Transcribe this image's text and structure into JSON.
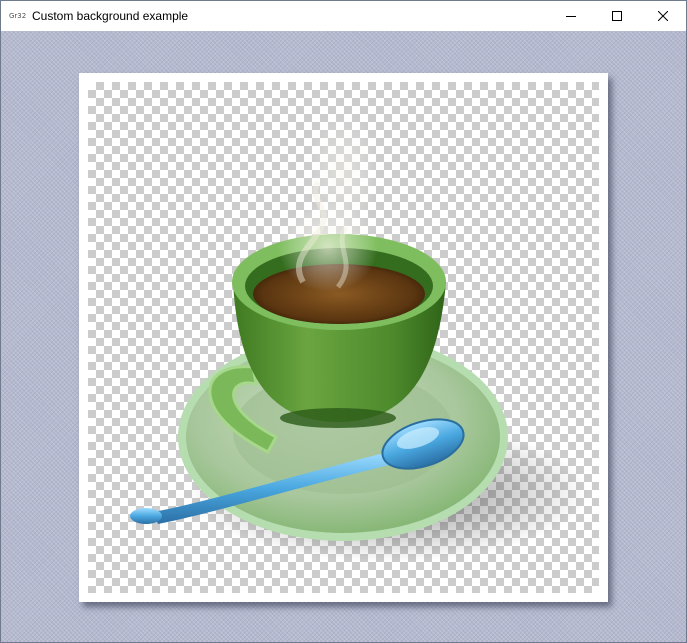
{
  "window": {
    "app_icon_text": "Gr32",
    "title": "Custom background example"
  },
  "caption": {
    "icons": [
      "minimize-icon",
      "maximize-icon",
      "close-icon"
    ]
  },
  "colors": {
    "desktop_background": "#b5b9cf",
    "cup_green": "#5e9a36",
    "saucer_green": "#a9c99a",
    "spoon_blue": "#5bb3e6"
  },
  "image": {
    "subject": "cup-of-coffee-with-spoon",
    "background": "transparency-checkerboard"
  }
}
